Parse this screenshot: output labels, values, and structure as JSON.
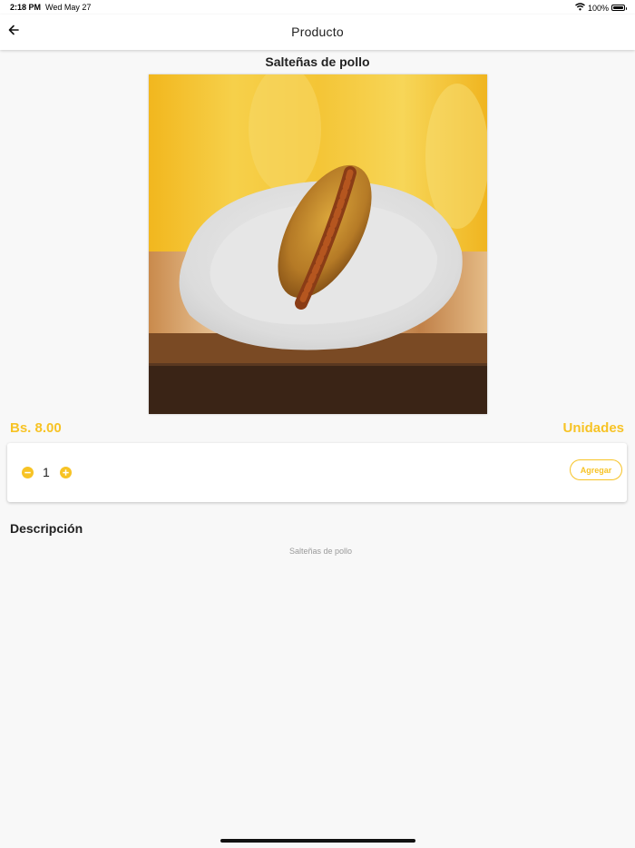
{
  "status_bar": {
    "time": "2:18 PM",
    "date": "Wed May 27",
    "battery": "100%",
    "icons": [
      "wifi-icon",
      "battery-icon"
    ]
  },
  "nav": {
    "title": "Producto",
    "back_icon": "arrow-left-icon"
  },
  "product": {
    "name": "Salteñas de pollo",
    "image_alt": "Salteña on a white plate",
    "price": "Bs. 8.00",
    "units_label": "Unidades",
    "quantity": "1",
    "add_label": "Agregar",
    "description_heading": "Descripción",
    "description": "Salteñas de pollo"
  },
  "colors": {
    "accent": "#f7c325",
    "background": "#f8f8f8",
    "text": "#222222",
    "muted": "#9a9a9a"
  }
}
